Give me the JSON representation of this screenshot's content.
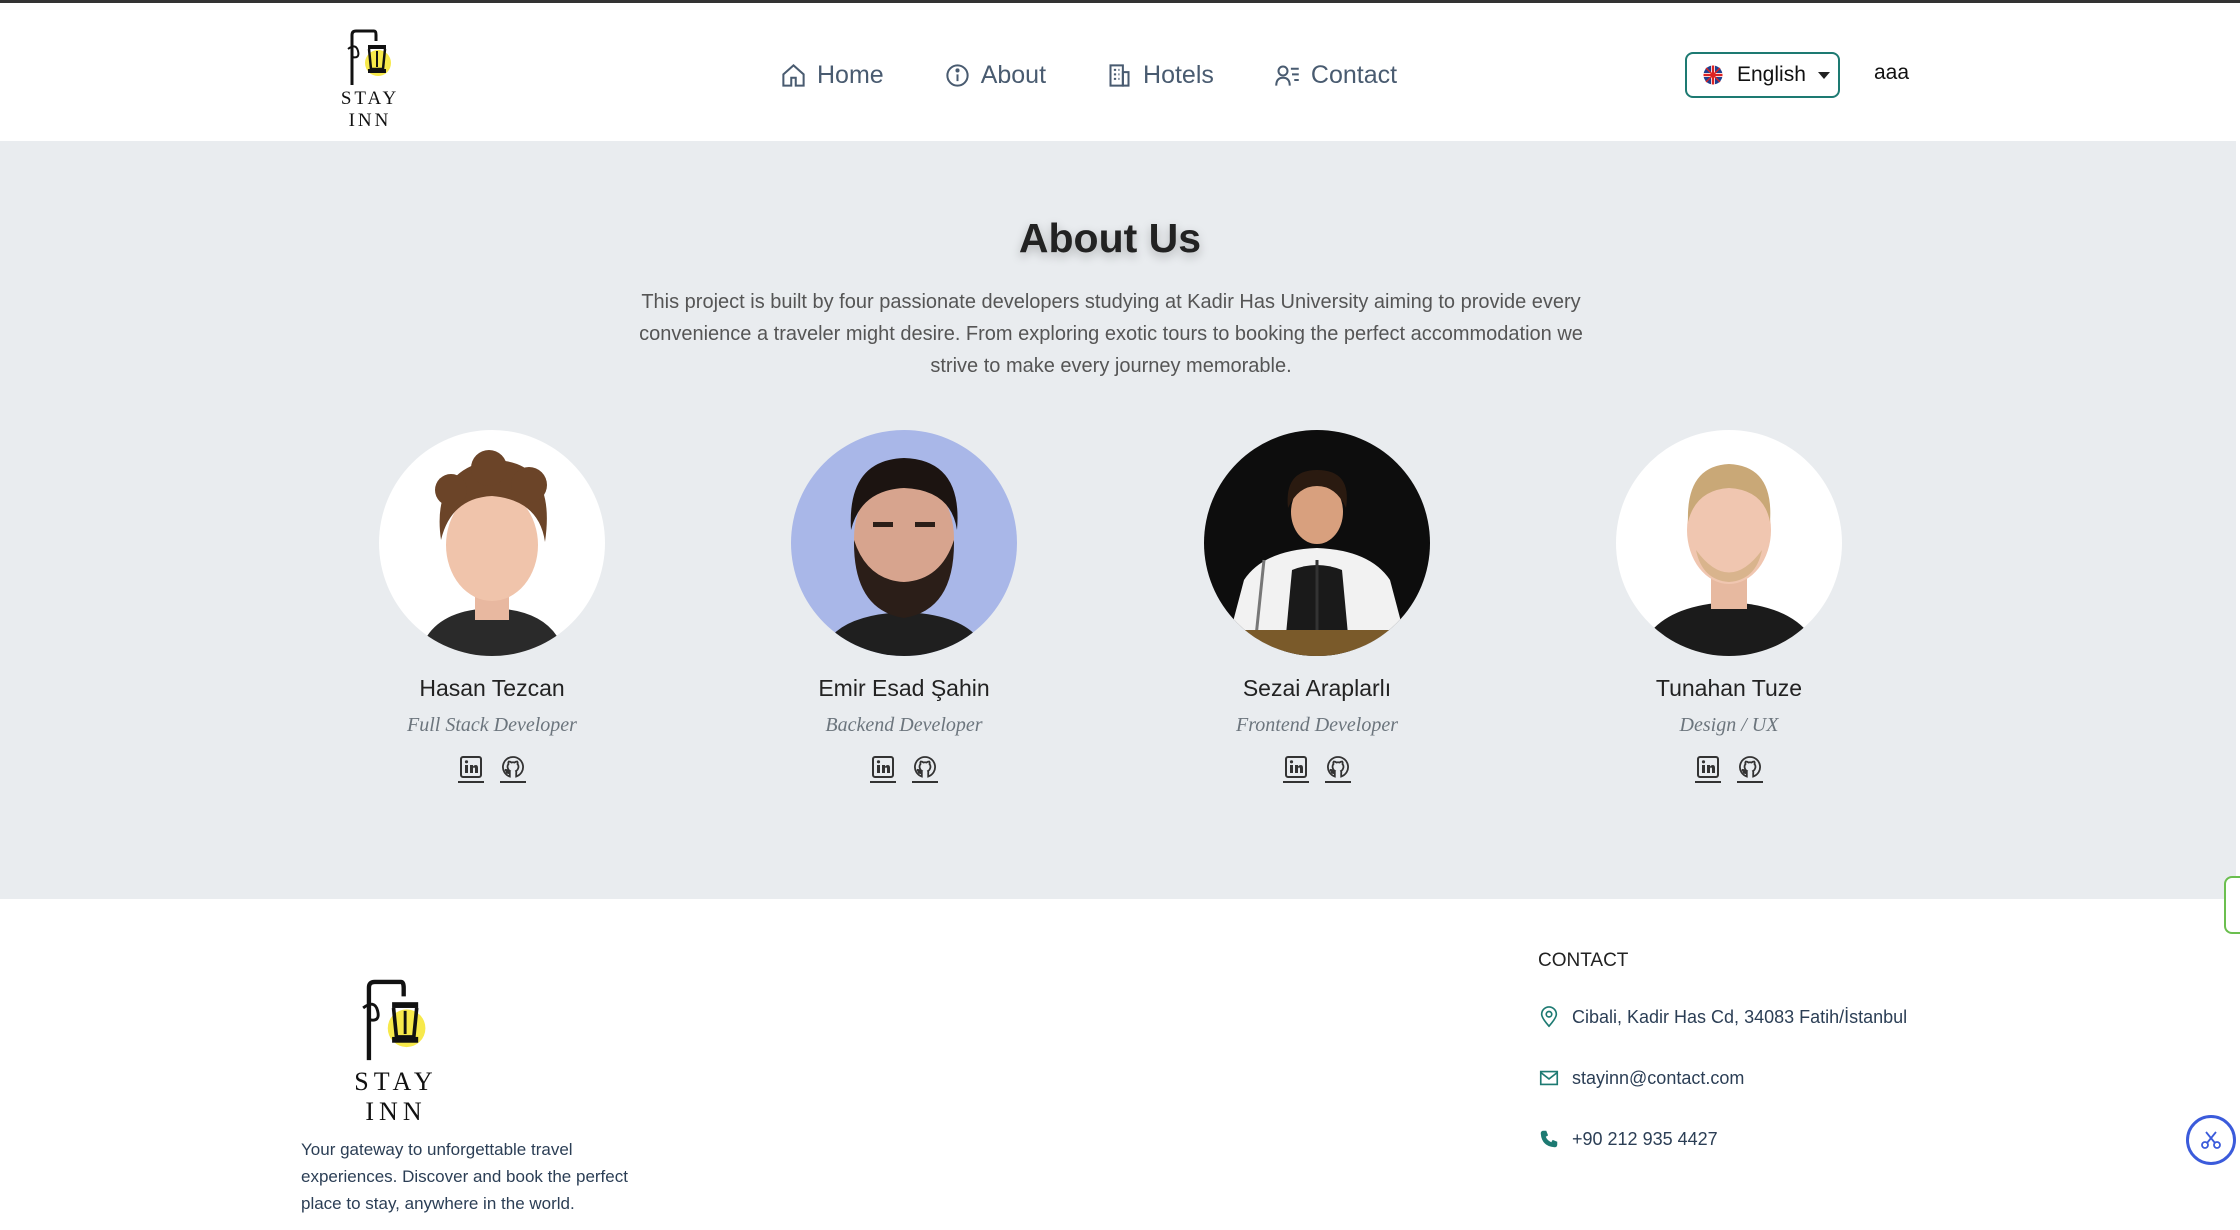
{
  "header": {
    "brand": "STAY INN",
    "nav": [
      {
        "label": "Home",
        "icon": "home-icon"
      },
      {
        "label": "About",
        "icon": "info-icon"
      },
      {
        "label": "Hotels",
        "icon": "building-icon"
      },
      {
        "label": "Contact",
        "icon": "contact-icon"
      }
    ],
    "language": "English",
    "username": "aaa"
  },
  "about": {
    "title": "About Us",
    "description": "This project is built by four passionate developers studying at Kadir Has University aiming to provide every convenience a traveler might desire. From exploring exotic tours to booking the perfect accommodation we strive to make every journey memorable.",
    "team": [
      {
        "name": "Hasan Tezcan",
        "role": "Full Stack Developer"
      },
      {
        "name": "Emir Esad Şahin",
        "role": "Backend Developer"
      },
      {
        "name": "Sezai Araplarlı",
        "role": "Frontend Developer"
      },
      {
        "name": "Tunahan Tuze",
        "role": "Design / UX"
      }
    ]
  },
  "footer": {
    "brand": "STAY INN",
    "description": "Your gateway to unforgettable travel experiences. Discover and book the perfect place to stay, anywhere in the world.",
    "contact_heading": "CONTACT",
    "address": "Cibali, Kadir Has Cd, 34083 Fatih/İstanbul",
    "email": "stayinn@contact.com",
    "phone": "+90 212 935 4427"
  },
  "colors": {
    "accent": "#1d7a72",
    "nav_text": "#495b70",
    "section_bg": "#e9ecef"
  }
}
